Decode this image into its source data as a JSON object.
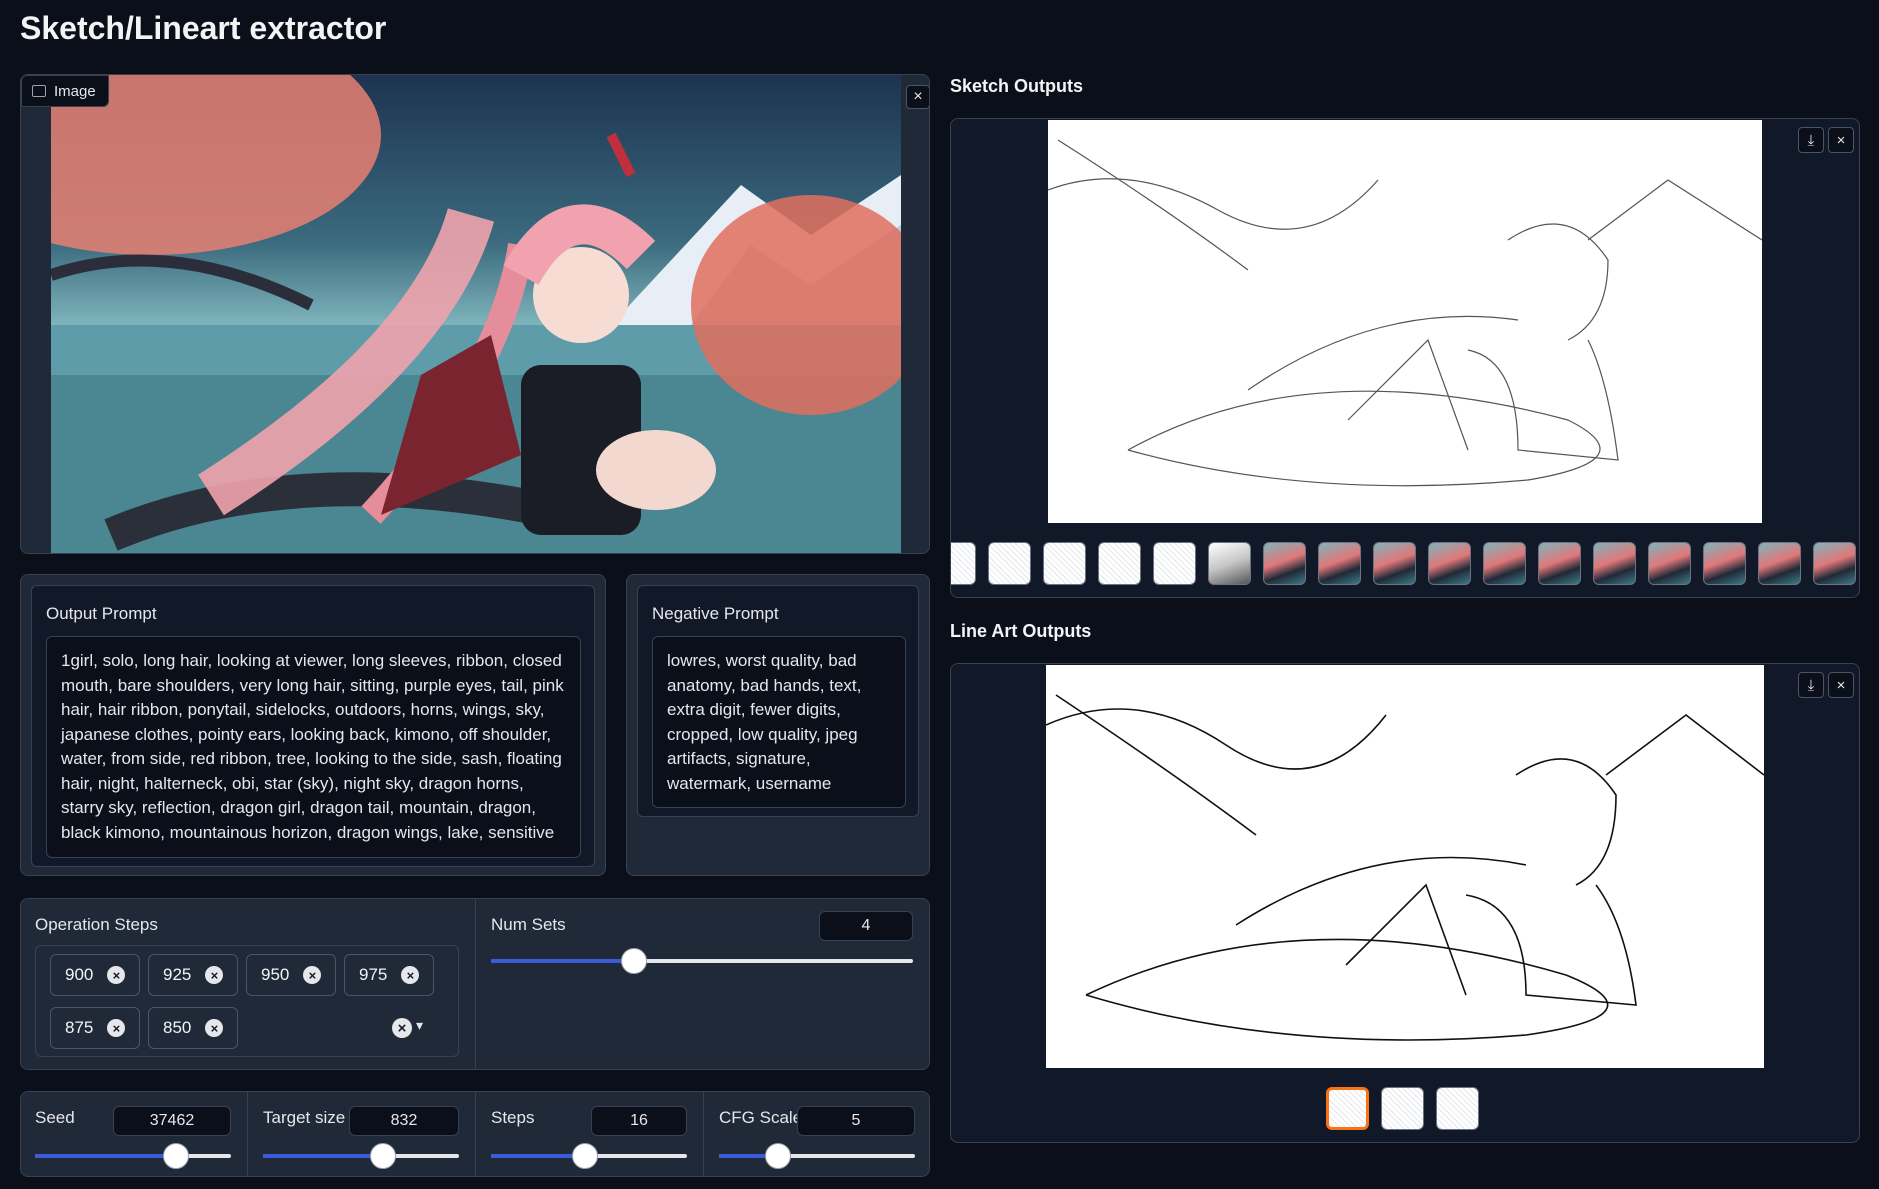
{
  "app": {
    "title": "Sketch/Lineart extractor"
  },
  "image_input": {
    "label": "Image"
  },
  "sketch_outputs": {
    "heading": "Sketch Outputs"
  },
  "lineart_outputs": {
    "heading": "Line Art Outputs"
  },
  "output_prompt": {
    "label": "Output Prompt",
    "value": "1girl, solo, long hair, looking at viewer, long sleeves, ribbon, closed mouth, bare shoulders, very long hair, sitting, purple eyes, tail, pink hair, hair ribbon, ponytail, sidelocks, outdoors, horns, wings, sky, japanese clothes, pointy ears, looking back, kimono, off shoulder, water, from side, red ribbon, tree, looking to the side, sash, floating hair, night, halterneck, obi, star (sky), night sky, dragon horns, starry sky, reflection, dragon girl, dragon tail, mountain, dragon, black kimono, mountainous horizon, dragon wings, lake, sensitive"
  },
  "negative_prompt": {
    "label": "Negative Prompt",
    "value": "lowres, worst quality, bad anatomy, bad hands, text, extra digit, fewer digits, cropped, low quality, jpeg artifacts, signature, watermark, username"
  },
  "operation_steps": {
    "label": "Operation Steps",
    "tags": [
      "900",
      "925",
      "950",
      "975",
      "875",
      "850"
    ]
  },
  "num_sets": {
    "label": "Num Sets",
    "value": "4",
    "level": 0.34
  },
  "seed": {
    "label": "Seed",
    "value": "37462",
    "level": 0.72
  },
  "target_size": {
    "label": "Target size",
    "value": "832",
    "level": 0.61
  },
  "steps": {
    "label": "Steps",
    "value": "16",
    "level": 0.48
  },
  "cfg_scale": {
    "label": "CFG Scale",
    "value": "5",
    "level": 0.3
  },
  "icons": {
    "close": "×",
    "download": "⤓",
    "dropdown": "▾",
    "image": "image-icon"
  }
}
